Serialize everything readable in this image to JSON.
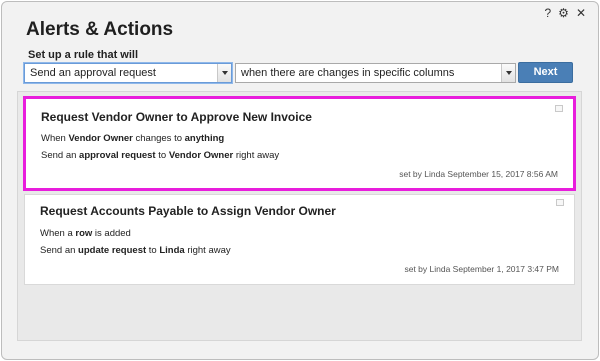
{
  "dialog": {
    "title": "Alerts & Actions",
    "icons": {
      "help": "?",
      "settings": "⚙",
      "close": "✕"
    }
  },
  "setup": {
    "label": "Set up a rule that will",
    "action_select": "Send an approval request",
    "trigger_select": "when there are changes in specific columns",
    "next_label": "Next"
  },
  "rules": [
    {
      "title": "Request Vendor Owner to Approve New Invoice",
      "line1": {
        "a": "When ",
        "b": "Vendor Owner",
        "c": " changes to ",
        "d": "anything"
      },
      "line2": {
        "a": "Send an ",
        "b": "approval request",
        "c": " to ",
        "d": "Vendor Owner",
        "e": " right away"
      },
      "meta": "set by Linda  September 15, 2017 8:56 AM",
      "selected": true
    },
    {
      "title": "Request Accounts Payable to Assign Vendor Owner",
      "line1": {
        "a": "When a ",
        "b": "row",
        "c": " is added"
      },
      "line2": {
        "a": "Send an ",
        "b": "update request",
        "c": " to ",
        "d": "Linda",
        "e": " right away"
      },
      "meta": "set by Linda  September 1, 2017 3:47 PM",
      "selected": false
    }
  ],
  "colors": {
    "accent": "#4a7fb6",
    "selection_highlight": "#e81ddc"
  }
}
